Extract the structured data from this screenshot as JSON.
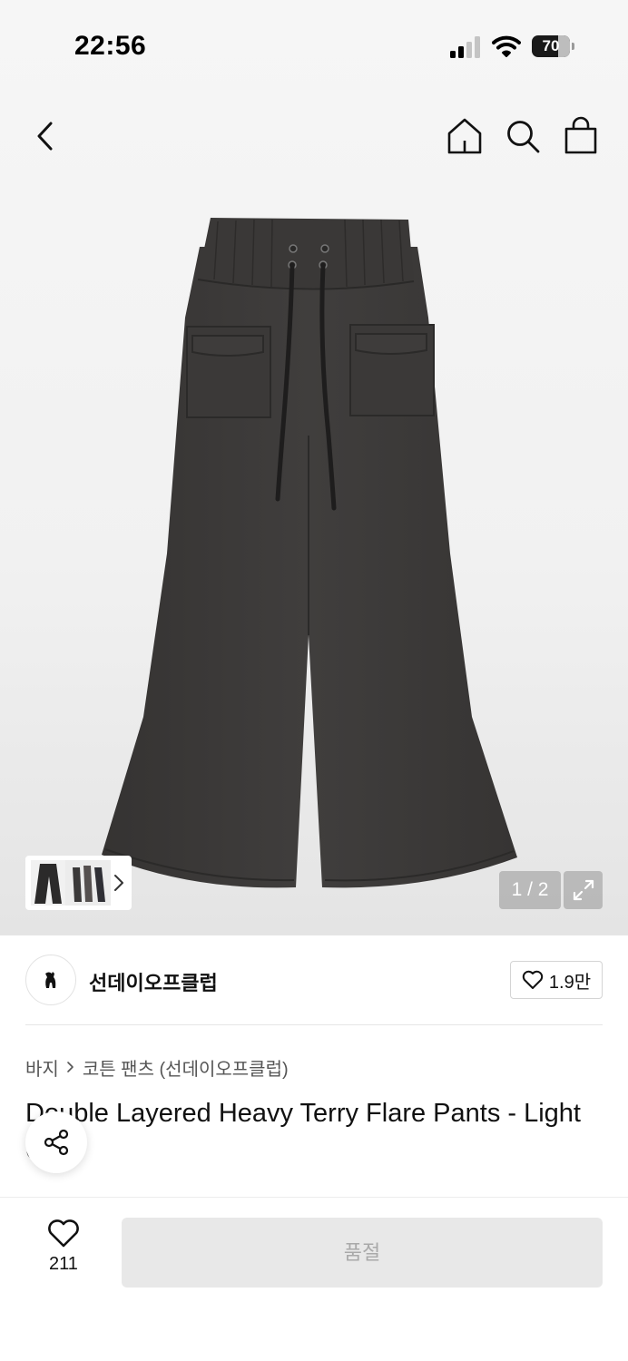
{
  "status_bar": {
    "time": "22:56",
    "battery_level": "70",
    "battery_fraction": 0.7,
    "icons": [
      "signal-icon",
      "wifi-icon",
      "battery-icon"
    ]
  },
  "nav": {
    "icons": [
      "back-icon",
      "home-icon",
      "search-icon",
      "shopping-bag-icon"
    ]
  },
  "gallery": {
    "page_indicator": "1 / 2",
    "current_page": 1,
    "total_pages": 2,
    "product_color": "#3d3b3a"
  },
  "brand": {
    "name": "선데이오프클럽",
    "likes": "1.9만"
  },
  "breadcrumb": {
    "items": [
      "바지",
      "코튼 팬츠 (선데이오프클럽)"
    ]
  },
  "product": {
    "title": "Double Layered Heavy Terry Flare Pants - Light Grey"
  },
  "bottom_bar": {
    "wish_count": "211",
    "soldout_label": "품절"
  },
  "colors": {
    "accent": "#111111",
    "disabled_bg": "#e8e8e8",
    "disabled_text": "#a9a9a9"
  }
}
